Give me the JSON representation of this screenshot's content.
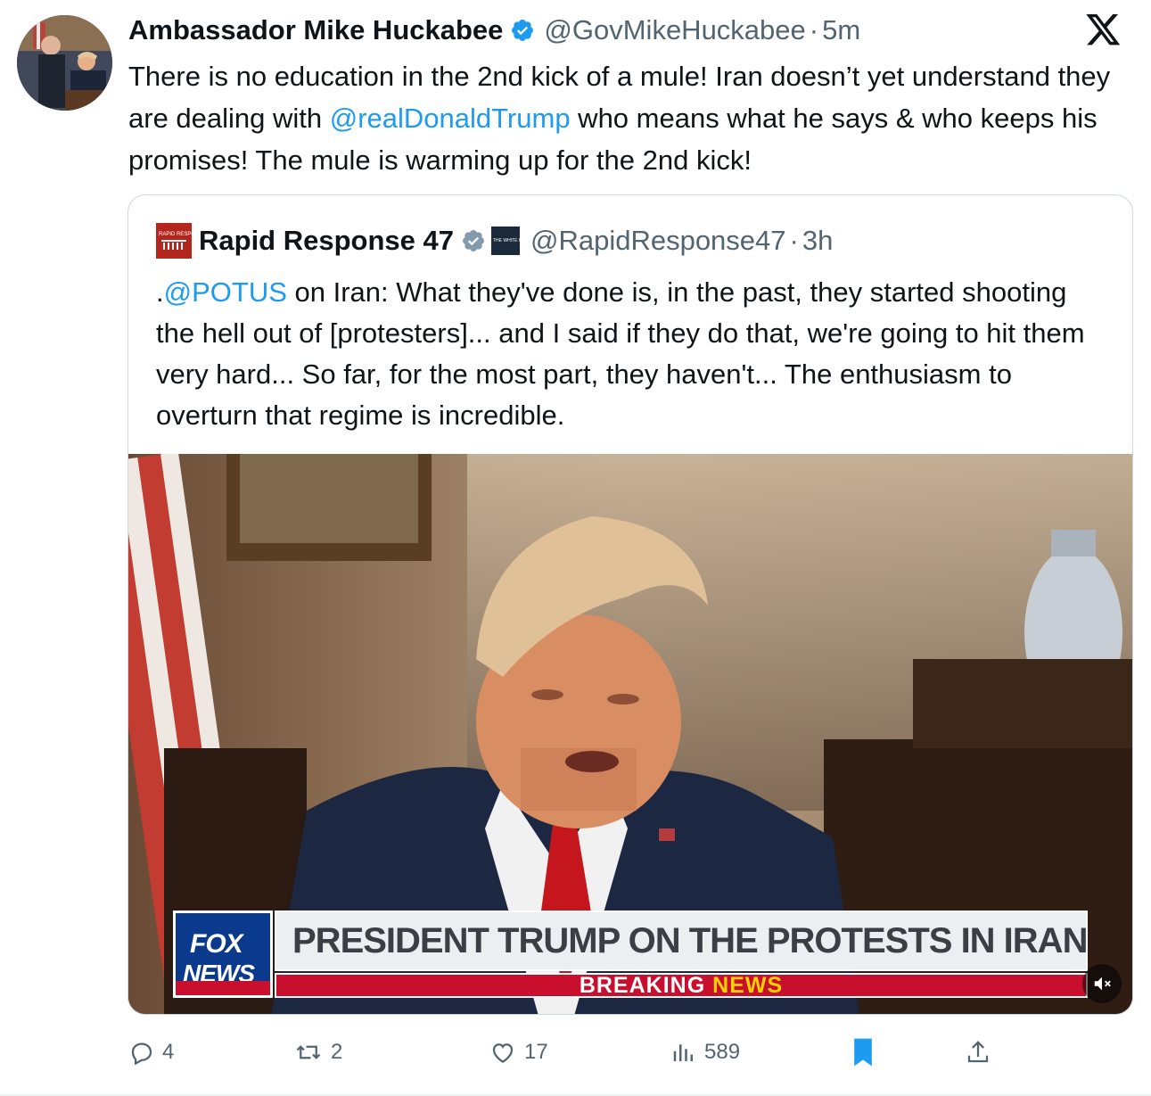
{
  "tweet": {
    "author_name": "Ambassador Mike Huckabee",
    "handle": "@GovMikeHuckabee",
    "separator": "·",
    "time": "5m",
    "text_part1": "There is no education in the 2nd kick of a mule! Iran doesn’t yet understand they are dealing with ",
    "mention": "@realDonaldTrump",
    "text_part2": " who means what he says & who keeps his promises!  The mule is warming up for the 2nd kick!"
  },
  "quoted_tweet": {
    "author_name": "Rapid Response 47",
    "handle": "@RapidResponse47",
    "separator": "·",
    "time": "3h",
    "logo_text": "RAPID RESPONSE",
    "affiliate_badge_text": "THE WHITE HOUSE",
    "text_prefix": ".",
    "mention": "@POTUS",
    "text_body": " on Iran: What they've done is, in the past, they started shooting the hell out of [protesters]... and I said if they do that, we're going to hit them very hard... So far, for the most part, they haven't... The enthusiasm to overturn that regime is incredible."
  },
  "video": {
    "network_line1": "FOX",
    "network_line2": "NEWS",
    "headline": "PRESIDENT TRUMP ON THE PROTESTS IN IRAN",
    "breaking_word1": "BREAKING",
    "breaking_word2": "NEWS",
    "mute_icon": "speaker-muted-icon"
  },
  "actions": {
    "replies": "4",
    "reposts": "2",
    "likes": "17",
    "views": "589"
  },
  "colors": {
    "link": "#1d9bf0",
    "muted": "#536471",
    "verified": "#1d9bf0",
    "bookmark": "#1d9bf0",
    "fox_blue": "#0b3a8c",
    "breaking_red": "#c8102e"
  }
}
